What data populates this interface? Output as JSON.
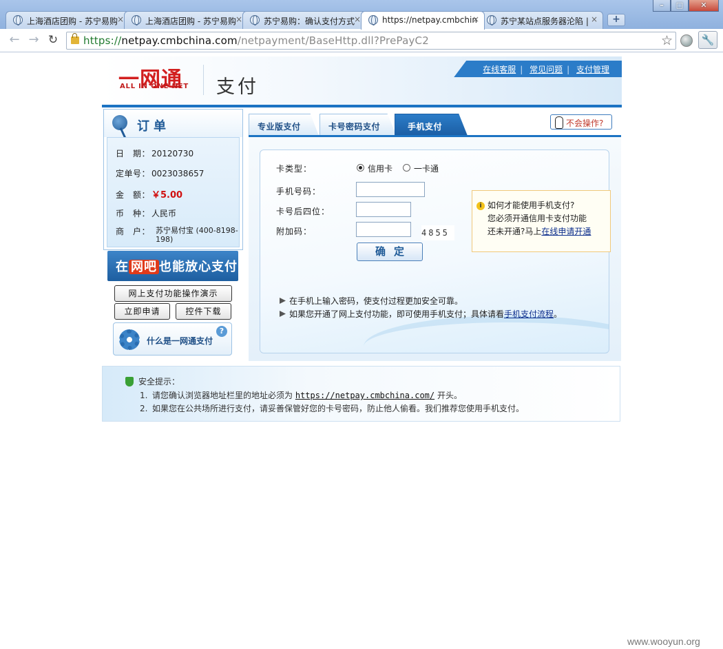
{
  "browser": {
    "tabs": [
      {
        "label": "上海酒店团购 - 苏宁易购",
        "active": false
      },
      {
        "label": "上海酒店团购 - 苏宁易购",
        "active": false
      },
      {
        "label": "苏宁易购：确认支付方式",
        "active": false
      },
      {
        "label": "https://netpay.cmbchin",
        "active": true
      },
      {
        "label": "苏宁某站点服务器沦陷 |",
        "active": false
      }
    ],
    "new_tab": "+",
    "close_glyph": "×",
    "url_proto": "https://",
    "url_host": "netpay.cmbchina.com",
    "url_path": "/netpayment/BaseHttp.dll?PrePayC2"
  },
  "header": {
    "logo_cn": "一网通",
    "logo_en": "ALL IN ONE NET",
    "title": "支付",
    "links": [
      "在线客服",
      "常见问题",
      "支付管理"
    ]
  },
  "order": {
    "title": "订单",
    "date_label": "日　期：",
    "date": "20120730",
    "order_no_label": "定单号：",
    "order_no": "0023038657",
    "amount_label": "金　额：",
    "amount": "￥5.00",
    "currency_label": "币　种：",
    "currency": "人民币",
    "merchant_label": "商　户：",
    "merchant": "苏宁易付宝 (400-8198-198)"
  },
  "left": {
    "netbar_pre": "在",
    "netbar_hl": "网吧",
    "netbar_post": "也能放心支付",
    "demo_btn": "网上支付功能操作演示",
    "apply_btn": "立即申请",
    "download_btn": "控件下载",
    "whatis": "什么是一网通支付"
  },
  "pay_tabs": [
    "专业版支付",
    "卡号密码支付",
    "手机支付"
  ],
  "help_btn": "不会操作?",
  "form": {
    "card_type_label": "卡类型：",
    "card_types": [
      "信用卡",
      "一卡通"
    ],
    "phone_label": "手机号码：",
    "last4_label": "卡号后四位：",
    "extra_label": "附加码：",
    "captcha": "4855",
    "ok": "确定",
    "tips": [
      "在手机上输入密码，使支付过程更加安全可靠。",
      "如果您开通了网上支付功能，即可使用手机支付；具体请看"
    ],
    "tip_link": "手机支付流程",
    "tip_end": "。"
  },
  "info": {
    "q": "如何才能使用手机支付?",
    "l1": "您必须开通信用卡支付功能",
    "l2": "还未开通?马上",
    "link": "在线申请开通"
  },
  "security": {
    "title": "安全提示：",
    "items": [
      {
        "num": "1.",
        "pre": "请您确认浏览器地址栏里的地址必须为",
        "url": "https://netpay.cmbchina.com/",
        "post": "开头。"
      },
      {
        "num": "2.",
        "pre": "如果您在公共场所进行支付，请妥善保管好您的卡号密码，防止他人偷看。我们推荐您使用手机支付。",
        "url": "",
        "post": ""
      }
    ]
  },
  "watermark": "www.wooyun.org"
}
